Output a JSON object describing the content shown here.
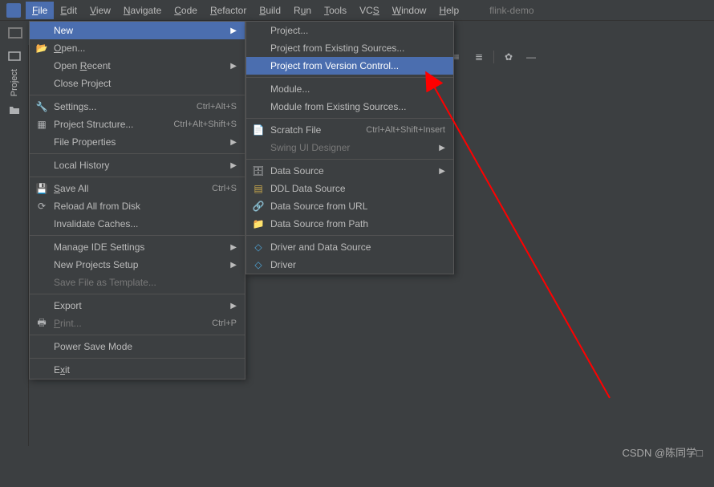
{
  "project_name": "flink-demo",
  "menubar": [
    "File",
    "Edit",
    "View",
    "Navigate",
    "Code",
    "Refactor",
    "Build",
    "Run",
    "Tools",
    "VCS",
    "Window",
    "Help"
  ],
  "left_tool_label": "Project",
  "file_menu": {
    "new": "New",
    "open": "Open...",
    "open_recent": "Open Recent",
    "close_project": "Close Project",
    "settings": "Settings...",
    "settings_sc": "Ctrl+Alt+S",
    "project_structure": "Project Structure...",
    "project_structure_sc": "Ctrl+Alt+Shift+S",
    "file_properties": "File Properties",
    "local_history": "Local History",
    "save_all": "Save All",
    "save_all_sc": "Ctrl+S",
    "reload": "Reload All from Disk",
    "invalidate": "Invalidate Caches...",
    "manage_ide": "Manage IDE Settings",
    "new_projects_setup": "New Projects Setup",
    "save_template": "Save File as Template...",
    "export": "Export",
    "print": "Print...",
    "print_sc": "Ctrl+P",
    "power_save": "Power Save Mode",
    "exit": "Exit"
  },
  "new_menu": {
    "project": "Project...",
    "project_existing": "Project from Existing Sources...",
    "project_vcs": "Project from Version Control...",
    "module": "Module...",
    "module_existing": "Module from Existing Sources...",
    "scratch": "Scratch File",
    "scratch_sc": "Ctrl+Alt+Shift+Insert",
    "swing": "Swing UI Designer",
    "data_source": "Data Source",
    "ddl": "DDL Data Source",
    "ds_url": "Data Source from URL",
    "ds_path": "Data Source from Path",
    "driver_ds": "Driver and Data Source",
    "driver": "Driver"
  },
  "watermark": "CSDN @陈同学□"
}
